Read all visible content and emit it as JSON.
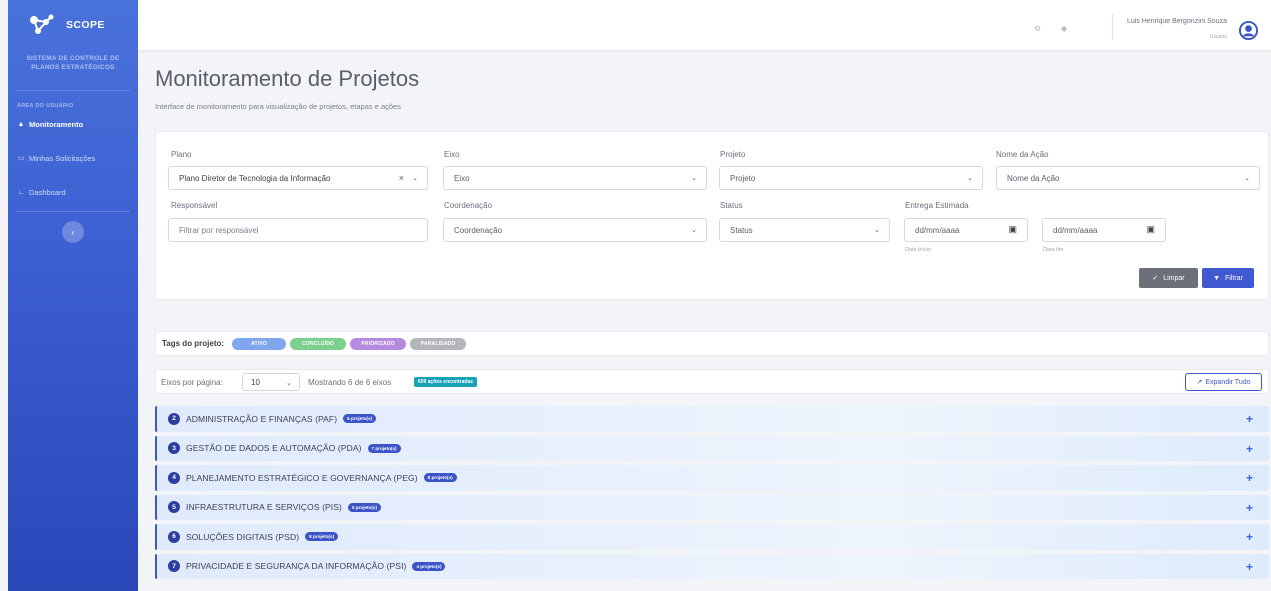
{
  "app": {
    "name": "SCOPE",
    "subtitle": "SISTEMA DE CONTROLE DE PLANOS ESTRATÉGICOS"
  },
  "sidebar": {
    "section": "ÁREA DO USUÁRIO",
    "items": [
      {
        "label": "Monitoramento",
        "icon": "binoculars-icon",
        "active": true
      },
      {
        "label": "Minhas Solicitações",
        "icon": "inbox-icon",
        "active": false
      },
      {
        "label": "Dashboard",
        "icon": "chart-line-icon",
        "active": false
      }
    ],
    "collapse_glyph": "‹"
  },
  "topbar": {
    "user_name": "Luis Henrique Bergonzini Souza",
    "user_role": "Usuário"
  },
  "page": {
    "title": "Monitoramento de Projetos",
    "subtitle": "Interface de monitoramento para visualização de projetos, etapas e ações"
  },
  "filters": {
    "plano": {
      "label": "Plano",
      "value": "Plano Diretor de Tecnologia da Informação"
    },
    "eixo": {
      "label": "Eixo",
      "value": "Eixo"
    },
    "projeto": {
      "label": "Projeto",
      "value": "Projeto"
    },
    "acao": {
      "label": "Nome da Ação",
      "value": "Nome da Ação"
    },
    "responsavel": {
      "label": "Responsável",
      "placeholder": "Filtrar por responsável"
    },
    "coordenacao": {
      "label": "Coordenação",
      "value": "Coordenação"
    },
    "status": {
      "label": "Status",
      "value": "Status"
    },
    "entrega": {
      "label": "Entrega Estimada",
      "start_placeholder": "dd/mm/aaaa",
      "end_placeholder": "dd/mm/aaaa",
      "start_hint": "Data início",
      "end_hint": "Data fim"
    },
    "clear_label": "Limpar",
    "filter_label": "Filtrar"
  },
  "tags": {
    "label": "Tags do projeto:",
    "items": [
      {
        "label": "ATIVO",
        "color": "#7fa6ee"
      },
      {
        "label": "CONCLUÍDO",
        "color": "#7ccf8d"
      },
      {
        "label": "PRIORIZADO",
        "color": "#b48be0"
      },
      {
        "label": "PARALISADO",
        "color": "#b3b5ba"
      }
    ]
  },
  "pager": {
    "per_page_label": "Eixos por página:",
    "per_page_value": "10",
    "showing": "Mostrando 6 de 6 eixos",
    "actions_badge": "609 ações encontradas",
    "expand_label": "Expandir Tudo"
  },
  "axes": [
    {
      "num": "2",
      "name": "ADMINISTRAÇÃO E FINANÇAS (PAF)",
      "badge": "5 projeto(s)"
    },
    {
      "num": "3",
      "name": "GESTÃO DE DADOS E AUTOMAÇÃO (PDA)",
      "badge": "7 projeto(s)"
    },
    {
      "num": "4",
      "name": "PLANEJAMENTO ESTRATÉGICO E GOVERNANÇA (PEG)",
      "badge": "8 projeto(s)"
    },
    {
      "num": "5",
      "name": "INFRAESTRUTURA E SERVIÇOS (PIS)",
      "badge": "5 projeto(s)"
    },
    {
      "num": "6",
      "name": "SOLUÇÕES DIGITAIS (PSD)",
      "badge": "8 projeto(s)"
    },
    {
      "num": "7",
      "name": "PRIVACIDADE E SEGURANÇA DA INFORMAÇÃO (PSI)",
      "badge": "4 projeto(s)"
    }
  ],
  "colors": {
    "primary": "#4058d0",
    "sidebar_top": "#4a72db",
    "sidebar_bottom": "#2a47b8",
    "info_badge": "#17a2b8"
  }
}
